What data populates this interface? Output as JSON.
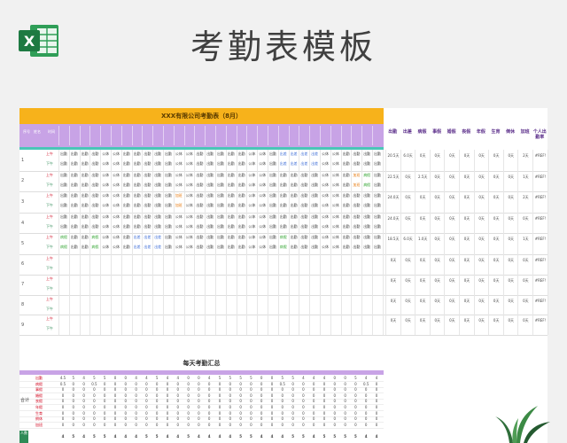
{
  "banner": {
    "title": "考勤表模板",
    "logo_icon": "excel-icon"
  },
  "sheet": {
    "caption": "XXX有限公司考勤表（8月）",
    "left_headers": [
      "序号",
      "姓名",
      "时间"
    ],
    "right_headers": [
      "出勤",
      "出差",
      "病假",
      "事假",
      "婚假",
      "丧假",
      "年假",
      "生育",
      "倒休",
      "加班",
      "个人出勤率"
    ],
    "rows": [
      {
        "num": "1",
        "am": "上午",
        "pm": "下午",
        "r": [
          "20.5天",
          "6.0天",
          "0天",
          "0天",
          "0天",
          "0天",
          "0天",
          "0天",
          "0天",
          "2天",
          "#REF!"
        ]
      },
      {
        "num": "2",
        "am": "上午",
        "pm": "下午",
        "r": [
          "22.5天",
          "0天",
          "2.5天",
          "0天",
          "0天",
          "0天",
          "0天",
          "0天",
          "0天",
          "1天",
          "#REF!"
        ]
      },
      {
        "num": "3",
        "am": "上午",
        "pm": "下午",
        "r": [
          "24.0天",
          "0天",
          "0天",
          "0天",
          "0天",
          "0天",
          "0天",
          "0天",
          "0天",
          "2天",
          "#REF!"
        ]
      },
      {
        "num": "4",
        "am": "上午",
        "pm": "下午",
        "r": [
          "24.0天",
          "0天",
          "0天",
          "0天",
          "0天",
          "0天",
          "0天",
          "0天",
          "0天",
          "0天",
          "#REF!"
        ]
      },
      {
        "num": "5",
        "am": "上午",
        "pm": "下午",
        "r": [
          "18.5天",
          "6.0天",
          "1.0天",
          "0天",
          "0天",
          "0天",
          "0天",
          "0天",
          "0天",
          "1天",
          "#REF!"
        ]
      },
      {
        "num": "6",
        "am": "上午",
        "pm": "下午",
        "r": [
          "0天",
          "0天",
          "0天",
          "0天",
          "0天",
          "0天",
          "0天",
          "0天",
          "0天",
          "0天",
          "#REF!"
        ]
      },
      {
        "num": "7",
        "am": "上午",
        "pm": "下午",
        "r": [
          "0天",
          "0天",
          "0天",
          "0天",
          "0天",
          "0天",
          "0天",
          "0天",
          "0天",
          "0天",
          "#REF!"
        ]
      },
      {
        "num": "8",
        "am": "上午",
        "pm": "下午",
        "r": [
          "0天",
          "0天",
          "0天",
          "0天",
          "0天",
          "0天",
          "0天",
          "0天",
          "0天",
          "0天",
          "#REF!"
        ]
      },
      {
        "num": "9",
        "am": "上午",
        "pm": "下午",
        "r": [
          "0天",
          "0天",
          "0天",
          "0天",
          "0天",
          "0天",
          "0天",
          "0天",
          "0天",
          "0天",
          "#REF!"
        ]
      }
    ],
    "cell_words": {
      "present": "出勤",
      "off": "公休",
      "trip": "出差",
      "sick": "病假",
      "ot": "加班"
    },
    "summary": {
      "title": "每天考勤汇总",
      "side_label": "合计",
      "people_label": "人数",
      "rows": [
        "出勤",
        "病假",
        "事假",
        "婚假",
        "丧假",
        "年假",
        "生育",
        "倒休",
        "加班"
      ]
    }
  }
}
